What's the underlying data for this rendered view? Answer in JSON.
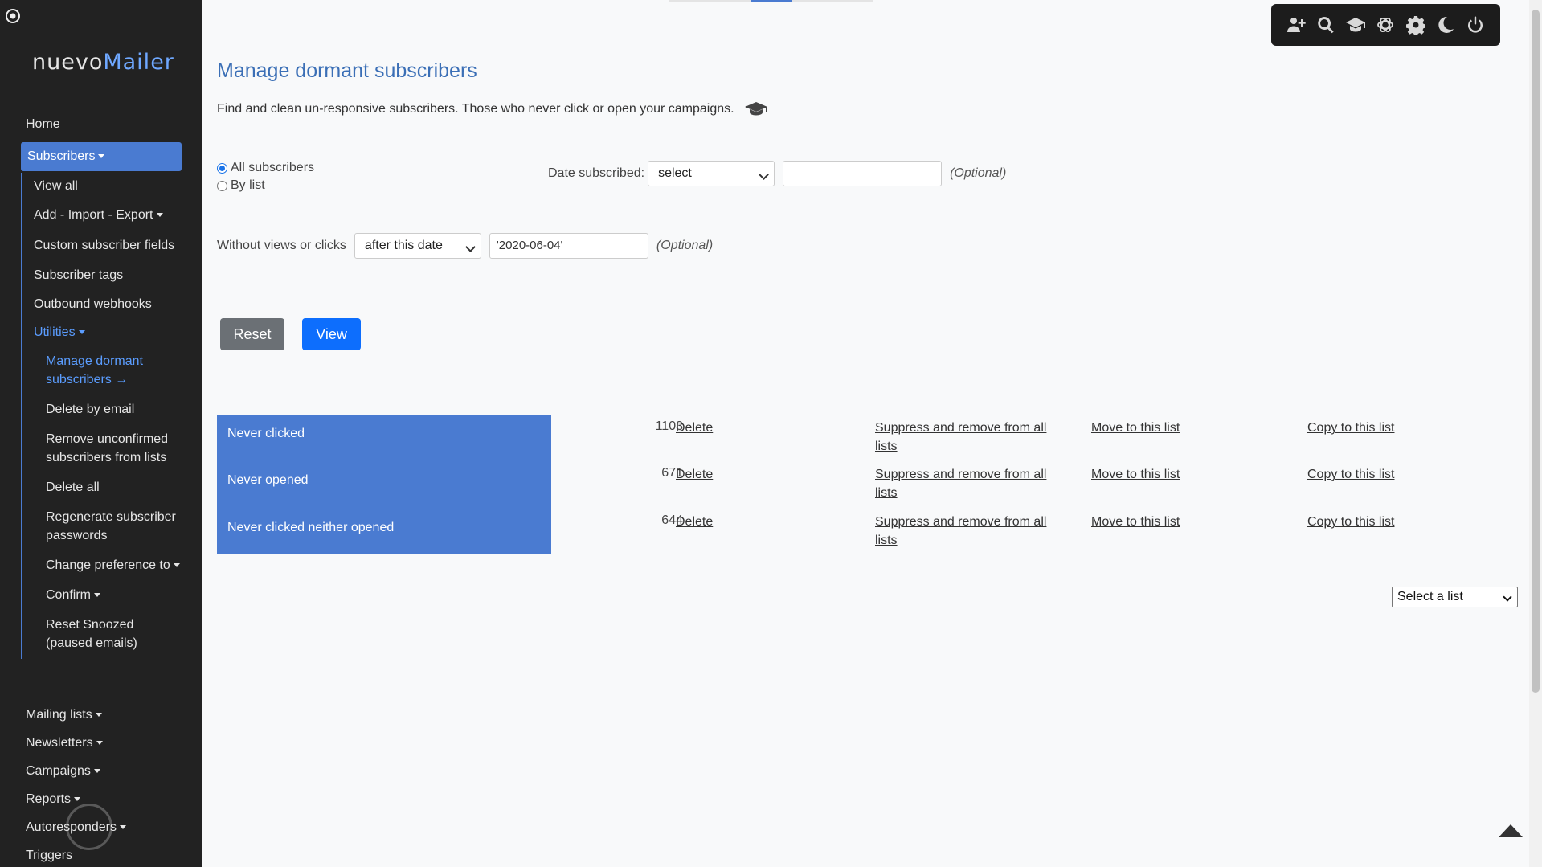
{
  "sidebar": {
    "brand": {
      "part1": "nuevo",
      "part2": "Mailer"
    },
    "home": "Home",
    "subscribers": "Subscribers",
    "subscriber_items": [
      "View all",
      "Add - Import - Export",
      "Custom subscriber fields",
      "Subscriber tags",
      "Outbound webhooks"
    ],
    "utilities": "Utilities",
    "utility_items": [
      "Manage dormant subscribers →",
      "Delete by email",
      "Remove unconfirmed subscribers from lists",
      "Delete all",
      "Regenerate subscriber passwords",
      "Change preference to",
      "Confirm",
      "Reset Snoozed (paused emails)"
    ],
    "bottom_items": [
      "Mailing lists",
      "Newsletters",
      "Campaigns",
      "Reports",
      "Autoresponders",
      "Triggers"
    ]
  },
  "toolbar": {
    "icons": [
      "add-user-icon",
      "search-icon",
      "graduation-cap-icon",
      "openai-icon",
      "gear-icon",
      "moon-icon",
      "power-icon"
    ]
  },
  "main": {
    "title": "Manage dormant subscribers",
    "description": "Find and clean un-responsive subscribers. Those who never click or open your campaigns.",
    "radio_all": "All subscribers",
    "radio_by_list": "By list",
    "date_subscribed_label": "Date subscribed:",
    "date_subscribed_select": "select",
    "date_subscribed_value": "",
    "optional": "(Optional)",
    "without_label": "Without views or clicks",
    "without_select": "after this date",
    "without_value": "'2020-06-04'",
    "reset": "Reset",
    "view": "View",
    "stats": [
      {
        "label": "Never clicked",
        "count": "1103"
      },
      {
        "label": "Never opened",
        "count": "671"
      },
      {
        "label": "Never clicked neither opened",
        "count": "644"
      }
    ],
    "delete_label": "Delete",
    "suppress_label_line1": "Suppress and remove from all",
    "suppress_label_line2": "lists",
    "move_label": "Move to this list",
    "copy_label": "Copy to this list",
    "list_select": "Select a list"
  }
}
